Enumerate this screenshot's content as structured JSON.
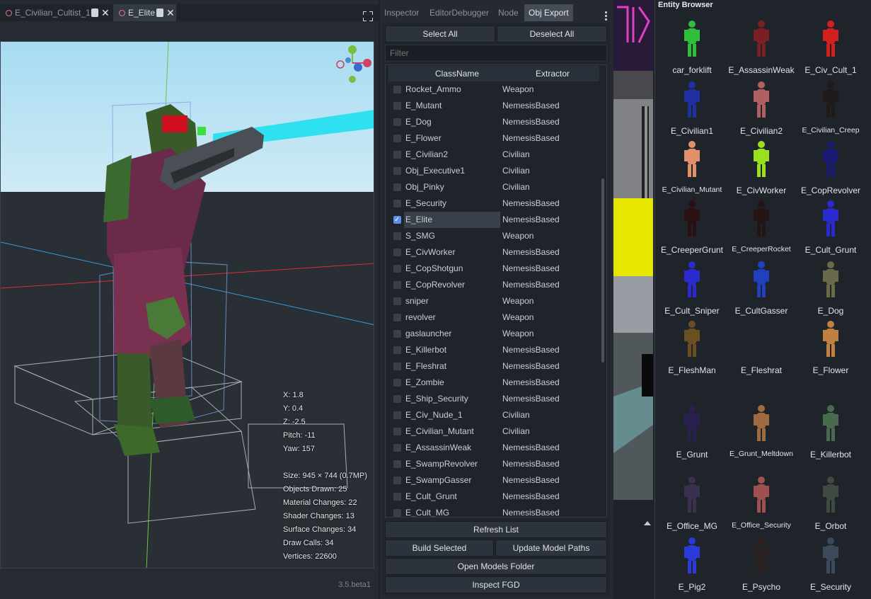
{
  "scene_tabs": [
    {
      "label": "E_Civilian_Cultist_1",
      "close": "✕"
    },
    {
      "label": "E_Elite",
      "close": "✕"
    }
  ],
  "viewport": {
    "stats": {
      "x": "X: 1.8",
      "y": "Y: 0.4",
      "z": "Z: -2.5",
      "pitch": "Pitch: -11",
      "yaw": "Yaw: 157",
      "size": "Size: 945 × 744 (0.7MP)",
      "objects": "Objects Drawn: 25",
      "materials": "Material Changes: 22",
      "shaders": "Shader Changes: 13",
      "surfaces": "Surface Changes: 34",
      "draw_calls": "Draw Calls: 34",
      "vertices": "Vertices: 22600"
    },
    "version": "3.5.beta1"
  },
  "dock": {
    "tabs": [
      "Inspector",
      "EditorDebugger",
      "Node",
      "Obj Export"
    ],
    "active_tab": "Obj Export",
    "select_all": "Select All",
    "deselect_all": "Deselect All",
    "filter_placeholder": "Filter",
    "columns": [
      "ClassName",
      "Extractor"
    ],
    "rows": [
      {
        "name": "Rocket_Ammo",
        "extractor": "Weapon",
        "checked": false
      },
      {
        "name": "E_Mutant",
        "extractor": "NemesisBased",
        "checked": false
      },
      {
        "name": "E_Dog",
        "extractor": "NemesisBased",
        "checked": false
      },
      {
        "name": "E_Flower",
        "extractor": "NemesisBased",
        "checked": false
      },
      {
        "name": "E_Civilian2",
        "extractor": "Civilian",
        "checked": false
      },
      {
        "name": "Obj_Executive1",
        "extractor": "Civilian",
        "checked": false
      },
      {
        "name": "Obj_Pinky",
        "extractor": "Civilian",
        "checked": false
      },
      {
        "name": "E_Security",
        "extractor": "NemesisBased",
        "checked": false
      },
      {
        "name": "E_Elite",
        "extractor": "NemesisBased",
        "checked": true
      },
      {
        "name": "S_SMG",
        "extractor": "Weapon",
        "checked": false
      },
      {
        "name": "E_CivWorker",
        "extractor": "NemesisBased",
        "checked": false
      },
      {
        "name": "E_CopShotgun",
        "extractor": "NemesisBased",
        "checked": false
      },
      {
        "name": "E_CopRevolver",
        "extractor": "NemesisBased",
        "checked": false
      },
      {
        "name": "sniper",
        "extractor": "Weapon",
        "checked": false
      },
      {
        "name": "revolver",
        "extractor": "Weapon",
        "checked": false
      },
      {
        "name": "gaslauncher",
        "extractor": "Weapon",
        "checked": false
      },
      {
        "name": "E_Killerbot",
        "extractor": "NemesisBased",
        "checked": false
      },
      {
        "name": "E_Fleshrat",
        "extractor": "NemesisBased",
        "checked": false
      },
      {
        "name": "E_Zombie",
        "extractor": "NemesisBased",
        "checked": false
      },
      {
        "name": "E_Ship_Security",
        "extractor": "NemesisBased",
        "checked": false
      },
      {
        "name": "E_Civ_Nude_1",
        "extractor": "Civilian",
        "checked": false
      },
      {
        "name": "E_Civilian_Mutant",
        "extractor": "Civilian",
        "checked": false
      },
      {
        "name": "E_AssassinWeak",
        "extractor": "NemesisBased",
        "checked": false
      },
      {
        "name": "E_SwampRevolver",
        "extractor": "NemesisBased",
        "checked": false
      },
      {
        "name": "E_SwampGasser",
        "extractor": "NemesisBased",
        "checked": false
      },
      {
        "name": "E_Cult_Grunt",
        "extractor": "NemesisBased",
        "checked": false
      },
      {
        "name": "E_Cult_MG",
        "extractor": "NemesisBased",
        "checked": false
      }
    ],
    "refresh_list": "Refresh List",
    "build_selected": "Build Selected",
    "update_model_paths": "Update Model Paths",
    "open_models_folder": "Open Models Folder",
    "inspect_fgd": "Inspect FGD"
  },
  "entity_browser": {
    "title": "Entity Browser",
    "items": [
      {
        "label": "car_forklift",
        "color": "#2fbf3a"
      },
      {
        "label": "E_AssassinWeak",
        "color": "#7a1f22"
      },
      {
        "label": "E_Civ_Cult_1",
        "color": "#d2201e"
      },
      {
        "label": "E_Civilian1",
        "color": "#2030a0"
      },
      {
        "label": "E_Civilian2",
        "color": "#b06060"
      },
      {
        "label": "E_Civilian_Creep",
        "color": "#201a1a"
      },
      {
        "label": "E_Civilian_Mutant",
        "color": "#e0906a"
      },
      {
        "label": "E_CivWorker",
        "color": "#9be01e"
      },
      {
        "label": "E_CopRevolver",
        "color": "#1a1a70"
      },
      {
        "label": "E_CreeperGrunt",
        "color": "#2a1010"
      },
      {
        "label": "E_CreeperRocket",
        "color": "#241414"
      },
      {
        "label": "E_Cult_Grunt",
        "color": "#2a2ad0"
      },
      {
        "label": "E_Cult_Sniper",
        "color": "#2a2ad0"
      },
      {
        "label": "E_CultGasser",
        "color": "#2040c0"
      },
      {
        "label": "E_Dog",
        "color": "#6a6a4a"
      },
      {
        "label": "E_FleshMan",
        "color": "#6a5020"
      },
      {
        "label": "E_Fleshrat",
        "color": "#1f242b"
      },
      {
        "label": "E_Flower",
        "color": "#c08040"
      },
      {
        "label": "E_Grunt",
        "color": "#2a2050"
      },
      {
        "label": "E_Grunt_Meltdown",
        "color": "#a06a40"
      },
      {
        "label": "E_Killerbot",
        "color": "#4a6a50"
      },
      {
        "label": "E_Office_MG",
        "color": "#3a3050"
      },
      {
        "label": "E_Office_Security",
        "color": "#a05050"
      },
      {
        "label": "E_Orbot",
        "color": "#404a40"
      },
      {
        "label": "E_Pig2",
        "color": "#2a3ad8"
      },
      {
        "label": "E_Psycho",
        "color": "#2a2020"
      },
      {
        "label": "E_Security",
        "color": "#3a4a5a"
      }
    ]
  }
}
